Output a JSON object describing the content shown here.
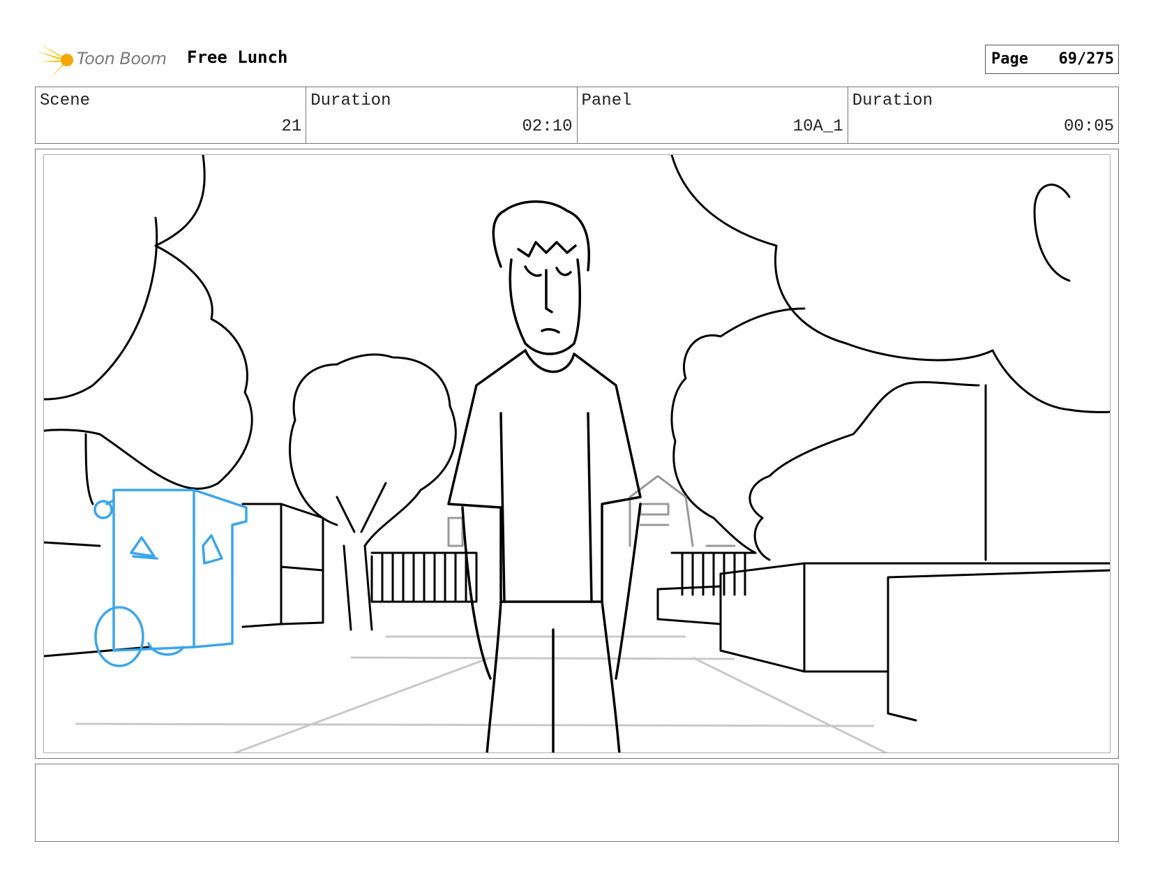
{
  "header": {
    "brand": "Toon Boom",
    "project_title": "Free Lunch",
    "page_label": "Page",
    "page_value": "69/275"
  },
  "info": {
    "scene_label": "Scene",
    "scene_value": "21",
    "scene_duration_label": "Duration",
    "scene_duration_value": "02:10",
    "panel_label": "Panel",
    "panel_value": "10A_1",
    "panel_duration_label": "Duration",
    "panel_duration_value": "00:05"
  },
  "notes": {
    "text": ""
  },
  "colors": {
    "logo_star": "#f5c400",
    "sketch_line": "#000000",
    "guide_line": "#c8c8c8",
    "recycle_bin": "#3aa5ec"
  }
}
